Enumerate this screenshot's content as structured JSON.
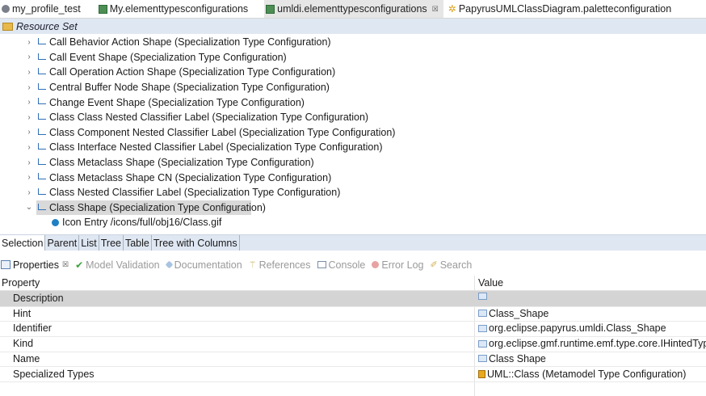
{
  "editor_tabs": [
    {
      "label": "my_profile_test",
      "icon": "profile-icon",
      "active": false
    },
    {
      "label": "My.elementtypesconfigurations",
      "icon": "elementtypes-icon",
      "active": false
    },
    {
      "label": "umldi.elementtypesconfigurations",
      "icon": "elementtypes-icon",
      "active": true,
      "close": "☒"
    },
    {
      "label": "PapyrusUMLClassDiagram.paletteconfiguration",
      "icon": "palette-icon",
      "active": false
    }
  ],
  "resource_set_label": "Resource Set",
  "tree": {
    "items": [
      {
        "label": "Call Behavior Action Shape (Specialization Type Configuration)",
        "chevron": "›"
      },
      {
        "label": "Call Event Shape (Specialization Type Configuration)",
        "chevron": "›"
      },
      {
        "label": "Call Operation Action Shape (Specialization Type Configuration)",
        "chevron": "›"
      },
      {
        "label": "Central Buffer Node Shape (Specialization Type Configuration)",
        "chevron": "›"
      },
      {
        "label": "Change Event Shape (Specialization Type Configuration)",
        "chevron": "›"
      },
      {
        "label": "Class Class Nested Classifier Label (Specialization Type Configuration)",
        "chevron": "›"
      },
      {
        "label": "Class Component Nested Classifier Label (Specialization Type Configuration)",
        "chevron": "›"
      },
      {
        "label": "Class Interface Nested Classifier Label (Specialization Type Configuration)",
        "chevron": "›"
      },
      {
        "label": "Class Metaclass Shape (Specialization Type Configuration)",
        "chevron": "›"
      },
      {
        "label": "Class Metaclass Shape CN (Specialization Type Configuration)",
        "chevron": "›"
      },
      {
        "label": "Class Nested Classifier Label (Specialization Type Configuration)",
        "chevron": "›"
      },
      {
        "label": "Class Shape (Specialization Type Configuration)",
        "chevron": "⌄",
        "selected": true
      }
    ],
    "child": {
      "label": "Icon Entry /icons/full/obj16/Class.gif"
    }
  },
  "viewer_tabs": [
    "Selection",
    "Parent",
    "List",
    "Tree",
    "Table",
    "Tree with Columns"
  ],
  "view_tabs": [
    {
      "label": "Properties",
      "icon": "properties-icon",
      "active": true,
      "close": "☒"
    },
    {
      "label": "Model Validation",
      "icon": "check-icon"
    },
    {
      "label": "Documentation",
      "icon": "documentation-icon"
    },
    {
      "label": "References",
      "icon": "references-icon"
    },
    {
      "label": "Console",
      "icon": "console-icon"
    },
    {
      "label": "Error Log",
      "icon": "error-log-icon"
    },
    {
      "label": "Search",
      "icon": "search-icon"
    }
  ],
  "properties": {
    "header_property": "Property",
    "header_value": "Value",
    "rows": [
      {
        "key": "Description",
        "value": "",
        "selected": true
      },
      {
        "key": "Hint",
        "value": "Class_Shape"
      },
      {
        "key": "Identifier",
        "value": "org.eclipse.papyrus.umldi.Class_Shape"
      },
      {
        "key": "Kind",
        "value": "org.eclipse.gmf.runtime.emf.type.core.IHintedType"
      },
      {
        "key": "Name",
        "value": "Class Shape"
      },
      {
        "key": "Specialized Types",
        "value": "UML::Class (Metamodel Type Configuration)",
        "icon": "metamodel-icon"
      }
    ]
  }
}
